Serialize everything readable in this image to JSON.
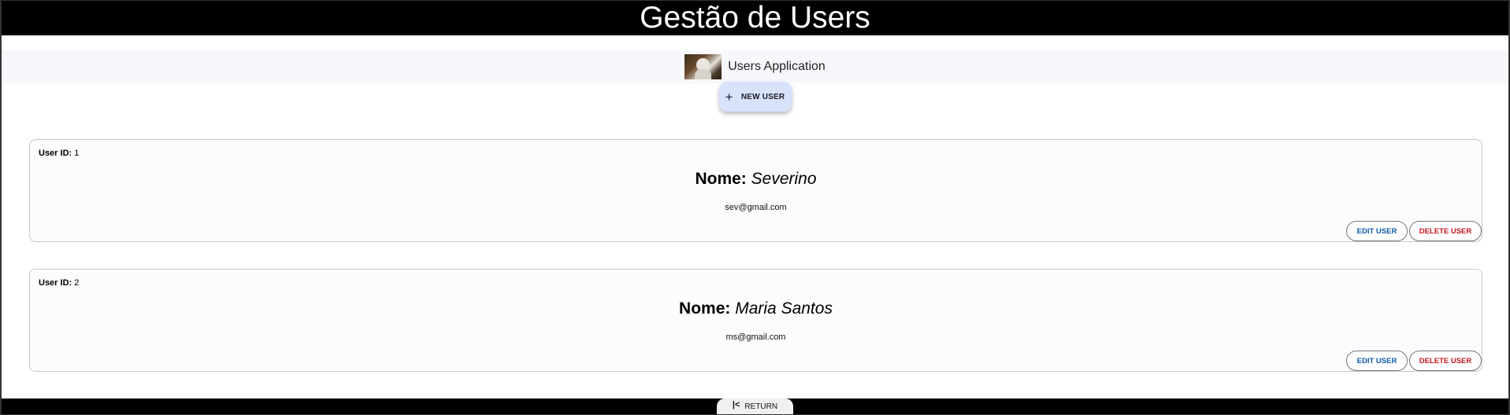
{
  "header": {
    "title": "Gestão de Users"
  },
  "app_bar": {
    "app_name": "Users Application",
    "logo_icon": "robot-avatar-icon"
  },
  "actions": {
    "new_user_label": "NEW USER",
    "new_user_icon": "plus-icon"
  },
  "users": [
    {
      "id_label": "User ID:",
      "id": "1",
      "name_label": "Nome:",
      "name": "Severino",
      "email": "sev@gmail.com",
      "edit_label": "EDIT USER",
      "delete_label": "DELETE USER"
    },
    {
      "id_label": "User ID:",
      "id": "2",
      "name_label": "Nome:",
      "name": "Maria Santos",
      "email": "ms@gmail.com",
      "edit_label": "EDIT USER",
      "delete_label": "DELETE USER"
    }
  ],
  "footer": {
    "return_label": "RETURN",
    "return_icon": "skip-back-icon"
  },
  "colors": {
    "header_bg": "#000000",
    "new_user_bg": "#d9e2fb",
    "edit_text": "#0b5aa8",
    "delete_text": "#c4161c",
    "card_bg": "#fcfbfe"
  }
}
